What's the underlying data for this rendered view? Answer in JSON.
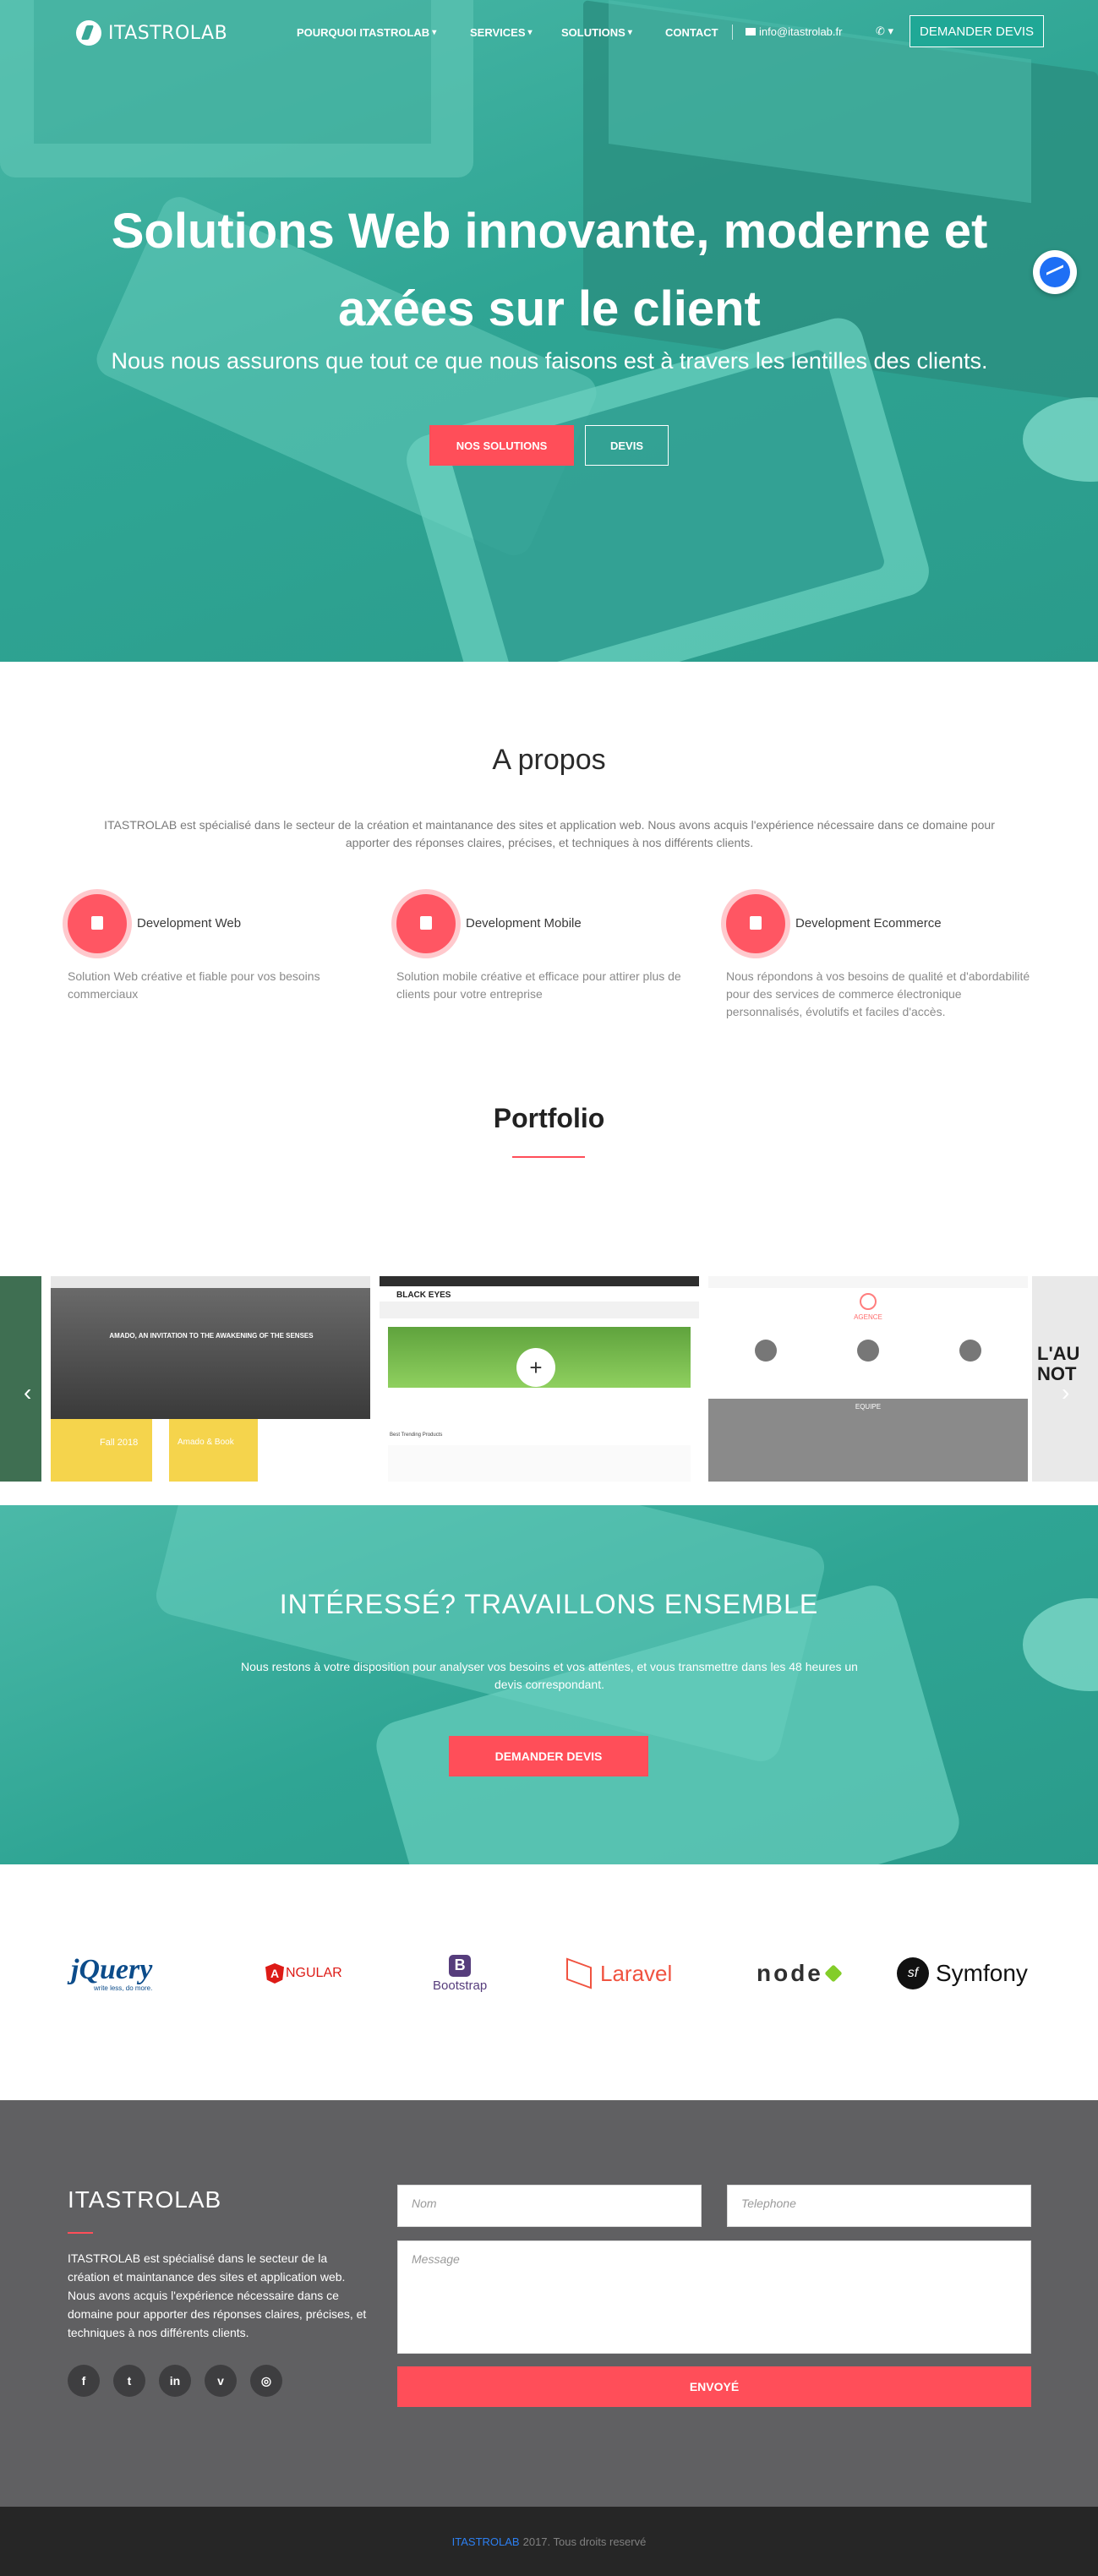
{
  "colors": {
    "accent": "#ff4e59",
    "teal": "#2fa594",
    "footer_bg": "#606062",
    "copyright_bg": "#262626"
  },
  "nav": {
    "logo": "ITASTROLAB",
    "items": [
      {
        "label": "POURQUOI ITASTROLAB",
        "icon": "caret-down-icon"
      },
      {
        "label": "SERVICES",
        "icon": "caret-down-icon"
      },
      {
        "label": "SOLUTIONS",
        "icon": "caret-down-icon"
      },
      {
        "label": "CONTACT"
      }
    ],
    "email": "info@itastrolab.fr",
    "phone_icon": "phone-icon",
    "cta": "DEMANDER DEVIS"
  },
  "hero": {
    "title_line1": "Solutions Web innovante, moderne et",
    "title_line2": "axées sur le client",
    "subtitle": "Nous nous assurons que tout ce que nous faisons est à travers les lentilles des clients.",
    "btn_primary": "NOS SOLUTIONS",
    "btn_secondary": "DEVIS"
  },
  "about": {
    "title": "A propos",
    "text": "ITASTROLAB est spécialisé dans le secteur de la création et maintanance des sites et application web. Nous avons acquis l'expérience nécessaire dans ce domaine pour apporter des réponses claires, précises, et techniques à nos différents clients.",
    "services": [
      {
        "title": "Development Web",
        "desc": "Solution Web créative et fiable pour vos besoins commerciaux",
        "icon": "globe-icon"
      },
      {
        "title": "Development Mobile",
        "desc": "Solution mobile créative et efficace pour attirer plus de clients pour votre entreprise",
        "icon": "mobile-icon"
      },
      {
        "title": "Development Ecommerce",
        "desc": "Nous répondons à vos besoins de qualité et d'abordabilité pour des services de commerce électronique personnalisés, évolutifs et faciles d'accès.",
        "icon": "cart-icon"
      }
    ]
  },
  "portfolio": {
    "title": "Portfolio",
    "slides": [
      {
        "caption": "AMADO, AN INVITATION TO THE AWAKENING OF THE SENSES",
        "tag1": "Fall 2018",
        "tag2": "Amado & Book"
      },
      {
        "caption": "BLACK EYES",
        "sub": "Best Trending Products"
      },
      {
        "caption": "AGENCE",
        "sub": "EQUIPE"
      },
      {
        "caption": "L'AU NOT"
      }
    ]
  },
  "cta": {
    "title": "INTÉRESSÉ? TRAVAILLONS ENSEMBLE",
    "text": "Nous restons à votre disposition pour analyser vos besoins et vos attentes, et vous transmettre dans les 48 heures un devis correspondant.",
    "button": "DEMANDER DEVIS"
  },
  "tech": {
    "jquery": "jQuery",
    "jquery_tag": "write less, do more.",
    "angular": "NGULAR",
    "angular_letter": "A",
    "bootstrap": "Bootstrap",
    "bootstrap_letter": "B",
    "laravel": "Laravel",
    "node": "node",
    "symfony": "Symfony",
    "symfony_letter": "sf"
  },
  "footer": {
    "title": "ITASTROLAB",
    "text": "ITASTROLAB est spécialisé dans le secteur de la création et maintanance des sites et application web. Nous avons acquis l'expérience nécessaire dans ce domaine pour apporter des réponses claires, précises, et techniques à nos différents clients.",
    "social": [
      "f",
      "t",
      "in",
      "v",
      "◎"
    ],
    "form": {
      "name_placeholder": "Nom",
      "phone_placeholder": "Telephone",
      "message_placeholder": "Message",
      "submit": "ENVOYÉ"
    },
    "copyright_brand": "ITASTROLAB",
    "copyright_text": "2017. Tous droits reservé"
  }
}
